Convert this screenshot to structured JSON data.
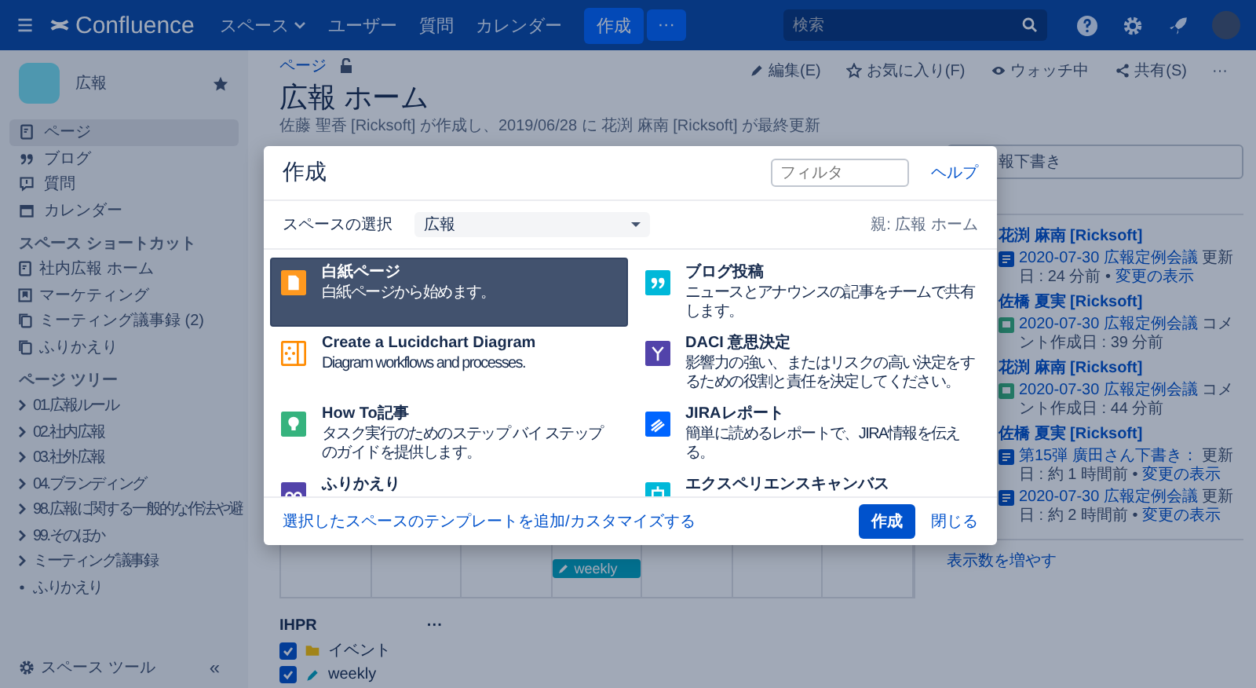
{
  "topbar": {
    "logo": "Confluence",
    "nav": [
      {
        "label": "スペース",
        "dropdown": true
      },
      {
        "label": "ユーザー",
        "dropdown": false
      },
      {
        "label": "質問",
        "dropdown": false
      },
      {
        "label": "カレンダー",
        "dropdown": false
      }
    ],
    "create": "作成",
    "more": "···",
    "search": {
      "placeholder": "検索"
    }
  },
  "sidebar": {
    "space_name": "広報",
    "starred": true,
    "nav": [
      {
        "label": "ページ",
        "kind": "page",
        "selected": true
      },
      {
        "label": "ブログ",
        "kind": "quote",
        "selected": false
      },
      {
        "label": "質問",
        "kind": "bubble",
        "selected": false
      },
      {
        "label": "カレンダー",
        "kind": "calendar",
        "selected": false
      }
    ],
    "shortcuts_heading": "スペース ショートカット",
    "shortcuts": [
      {
        "label": "社内広報 ホーム",
        "kind": "page"
      },
      {
        "label": "マーケティング",
        "kind": "bookmark"
      },
      {
        "label": "ミーティング議事録 (2)",
        "kind": "copy"
      },
      {
        "label": "ふりかえり",
        "kind": "copy"
      }
    ],
    "tree_heading": "ページ ツリー",
    "tree": [
      {
        "label": "01.広報ルール",
        "expandable": true
      },
      {
        "label": "02.社内広報",
        "expandable": true
      },
      {
        "label": "03.社外広報",
        "expandable": true
      },
      {
        "label": "04.ブランディング",
        "expandable": true
      },
      {
        "label": "98.広報に関する一般的な作法や避",
        "expandable": true
      },
      {
        "label": "99.そのほか",
        "expandable": true
      },
      {
        "label": "ミーティング議事録",
        "expandable": true
      },
      {
        "label": "ふりかえり",
        "expandable": false
      }
    ],
    "tools": "スペース ツール",
    "collapse": "«"
  },
  "page": {
    "breadcrumb": "ページ",
    "title": "広報 ホーム",
    "byline": "佐藤 聖香 [Ricksoft] が作成し、2019/06/28 に 花渕 麻南 [Ricksoft] が最終更新",
    "actions": [
      {
        "kind": "edit",
        "label": "編集(E)"
      },
      {
        "kind": "star",
        "label": "お気に入り(F)"
      },
      {
        "kind": "watch",
        "label": "ウォッチ中"
      },
      {
        "kind": "share",
        "label": "共有(S)"
      },
      {
        "kind": "more",
        "label": "···"
      }
    ],
    "calendar_event": "weekly",
    "ihpr": {
      "title": "IHPR",
      "more": "···",
      "calendars": [
        {
          "label": "イベント",
          "kind": "folder",
          "checked": true
        },
        {
          "label": "weekly",
          "kind": "pencil",
          "checked": true
        }
      ]
    }
  },
  "activity": {
    "draft_box": "報下書き",
    "items": [
      {
        "kind": "user",
        "name": "花渕 麻南 [Ricksoft]"
      },
      {
        "kind": "page_update",
        "link": "2020-07-30 広報定例会議",
        "detail": " 更新日 : 24 分前 • ",
        "change": "変更の表示"
      },
      {
        "kind": "user",
        "name": "佐橋 夏実 [Ricksoft]"
      },
      {
        "kind": "comment",
        "link": "2020-07-30 広報定例会議",
        "detail": " コメント作成日 : 39 分前"
      },
      {
        "kind": "user",
        "name": "花渕 麻南 [Ricksoft]"
      },
      {
        "kind": "comment",
        "link": "2020-07-30 広報定例会議",
        "detail": " コメント作成日 : 44 分前"
      },
      {
        "kind": "user",
        "name": "佐橋 夏実 [Ricksoft]"
      },
      {
        "kind": "page_update",
        "link": "第15弾 廣田さん下書き：",
        "detail": " 更新日 : 約 1 時間前 • ",
        "change": "変更の表示"
      },
      {
        "kind": "page_update",
        "link": "2020-07-30 広報定例会議",
        "detail": " 更新日 : 約 2 時間前 • ",
        "change": "変更の表示"
      }
    ],
    "more": "表示数を増やす"
  },
  "dialog": {
    "title": "作成",
    "filter": {
      "placeholder": "フィルタ"
    },
    "help": "ヘルプ",
    "space_label": "スペースの選択",
    "space_value": "広報",
    "parent": "親: 広報 ホーム",
    "templates": [
      {
        "kind": "blank",
        "title": "白紙ページ",
        "description": "白紙ページから始めます。",
        "selected": true,
        "color": "#ff991f"
      },
      {
        "kind": "blog",
        "title": "ブログ投稿",
        "description": "ニュースとアナウンスの記事をチームで共有します。",
        "selected": false,
        "color": "#00b8d9"
      },
      {
        "kind": "lucidchart",
        "title": "Create a Lucidchart Diagram",
        "description": "Diagram workflows and processes.",
        "selected": false,
        "color": "#ff8b00"
      },
      {
        "kind": "daci",
        "title": "DACI 意思決定",
        "description": "影響力の強い、またはリスクの高い決定をするための役割と責任を決定してください。",
        "selected": false,
        "color": "#5243aa"
      },
      {
        "kind": "howto",
        "title": "How To記事",
        "description": "タスク実行のためのステップ バイ ステップのガイドを提供します。",
        "selected": false,
        "color": "#36b37e"
      },
      {
        "kind": "jira",
        "title": "JIRAレポート",
        "description": "簡単に読めるレポートで、JIRA情報を伝える。",
        "selected": false,
        "color": "#0065ff"
      },
      {
        "kind": "retro",
        "title": "ふりかえり",
        "selected": false,
        "color": "#5243aa"
      },
      {
        "kind": "canvas",
        "title": "エクスペリエンスキャンバス",
        "selected": false,
        "color": "#00b8d9"
      }
    ],
    "footer_link": "選択したスペースのテンプレートを追加/カスタマイズする",
    "create": "作成",
    "close": "閉じる"
  }
}
